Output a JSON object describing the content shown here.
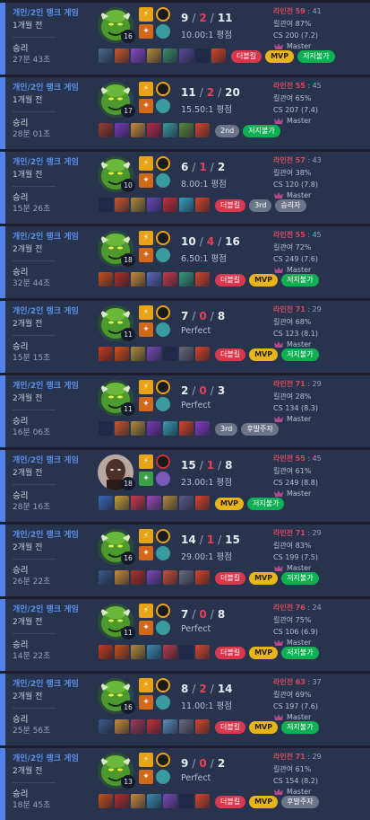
{
  "matches": [
    {
      "mode": "개인/2인 랭크 게임",
      "ago": "1개월 전",
      "result": "승리",
      "duration": "27분 43초",
      "champion": "green-brute",
      "level": "16",
      "spell_colors": [
        "#e8a317",
        "#d4681a"
      ],
      "rune_colors": [
        "#e8a317",
        "#3b9aa0"
      ],
      "kills": "9",
      "deaths": "2",
      "assists": "11",
      "ratio": "10.00:1 평점",
      "items": [
        "#4a6a8a",
        "#c85a2a",
        "#8a4ac8",
        "#b08a3a",
        "#3a8a6a",
        "#5a4a9a",
        "empty",
        "#d8452a"
      ],
      "badges": [
        {
          "label": "더블킬",
          "kind": "t"
        },
        {
          "label": "MVP",
          "kind": "m"
        },
        {
          "label": "저지불가",
          "kind": "g"
        }
      ],
      "lane_label": "라인전",
      "lane_score": "59",
      "lane_opp": "41",
      "kp": "킬관여 87%",
      "cs": "CS 200 (7.2)",
      "tier": "Master"
    },
    {
      "mode": "개인/2인 랭크 게임",
      "ago": "1개월 전",
      "result": "승리",
      "duration": "28분 01초",
      "champion": "green-brute",
      "level": "17",
      "spell_colors": [
        "#e8a317",
        "#d4681a"
      ],
      "rune_colors": [
        "#e8a317",
        "#3b9aa0"
      ],
      "kills": "11",
      "deaths": "2",
      "assists": "20",
      "ratio": "15.50:1 평점",
      "items": [
        "#a03a2a",
        "#7a3ab8",
        "#c88a3a",
        "#b82a4a",
        "#3a9a9a",
        "#5a8a3a",
        "#d8452a"
      ],
      "badges": [
        {
          "label": "2nd",
          "kind": "r"
        },
        {
          "label": "저지불가",
          "kind": "g"
        }
      ],
      "lane_label": "라인전",
      "lane_score": "55",
      "lane_opp": "45",
      "kp": "킬관여 65%",
      "cs": "CS 207 (7.4)",
      "tier": "Master"
    },
    {
      "mode": "개인/2인 랭크 게임",
      "ago": "1개월 전",
      "result": "승리",
      "duration": "15분 26초",
      "champion": "green-brute",
      "level": "10",
      "spell_colors": [
        "#e8a317",
        "#d4681a"
      ],
      "rune_colors": [
        "#e8a317",
        "#3b9aa0"
      ],
      "kills": "6",
      "deaths": "1",
      "assists": "2",
      "ratio": "8.00:1 평점",
      "items": [
        "empty",
        "#c85a2a",
        "#b08a3a",
        "#6a4ab8",
        "#c8303a",
        "#3aa0c0",
        "#d8452a"
      ],
      "badges": [
        {
          "label": "더블킬",
          "kind": "t"
        },
        {
          "label": "3rd",
          "kind": "r"
        },
        {
          "label": "승리자",
          "kind": "r"
        }
      ],
      "lane_label": "라인전",
      "lane_score": "57",
      "lane_opp": "43",
      "kp": "킬관여 38%",
      "cs": "CS 120 (7.8)",
      "tier": "Master"
    },
    {
      "mode": "개인/2인 랭크 게임",
      "ago": "2개월 전",
      "result": "승리",
      "duration": "32분 44초",
      "champion": "green-brute",
      "level": "18",
      "spell_colors": [
        "#e8a317",
        "#d4681a"
      ],
      "rune_colors": [
        "#e8a317",
        "#3b9aa0"
      ],
      "kills": "10",
      "deaths": "4",
      "assists": "16",
      "ratio": "6.50:1 평점",
      "items": [
        "#c8501a",
        "#b0302a",
        "#c88a3a",
        "#5a6ab8",
        "#c83a4a",
        "#3a9a7a",
        "#d8452a"
      ],
      "badges": [
        {
          "label": "더블킬",
          "kind": "t"
        },
        {
          "label": "MVP",
          "kind": "m"
        },
        {
          "label": "저지불가",
          "kind": "g"
        }
      ],
      "lane_label": "라인전",
      "lane_score": "55",
      "lane_opp": "45",
      "kp": "킬관여 72%",
      "cs": "CS 249 (7.6)",
      "tier": "Master"
    },
    {
      "mode": "개인/2인 랭크 게임",
      "ago": "2개월 전",
      "result": "승리",
      "duration": "15분 15초",
      "champion": "green-brute",
      "level": "11",
      "spell_colors": [
        "#e8a317",
        "#d4681a"
      ],
      "rune_colors": [
        "#e8a317",
        "#3b9aa0"
      ],
      "kills": "7",
      "deaths": "0",
      "assists": "8",
      "ratio": "Perfect",
      "items": [
        "#c83a1a",
        "#d8501a",
        "#b08a3a",
        "#7a4ab8",
        "empty",
        "#6a6a7a",
        "#d8452a"
      ],
      "badges": [
        {
          "label": "더블킬",
          "kind": "t"
        },
        {
          "label": "MVP",
          "kind": "m"
        },
        {
          "label": "저지불가",
          "kind": "g"
        }
      ],
      "lane_label": "라인전",
      "lane_score": "71",
      "lane_opp": "29",
      "kp": "킬관여 68%",
      "cs": "CS 123 (8.1)",
      "tier": "Master"
    },
    {
      "mode": "개인/2인 랭크 게임",
      "ago": "2개월 전",
      "result": "승리",
      "duration": "16분 06초",
      "champion": "green-brute",
      "level": "11",
      "spell_colors": [
        "#e8a317",
        "#d4681a"
      ],
      "rune_colors": [
        "#e8a317",
        "#3b9aa0"
      ],
      "kills": "2",
      "deaths": "0",
      "assists": "3",
      "ratio": "Perfect",
      "items": [
        "empty",
        "#c85a2a",
        "#b08a3a",
        "#7a3ab8",
        "#3a9ab0",
        "#d8452a",
        "#8a3ac8"
      ],
      "badges": [
        {
          "label": "3rd",
          "kind": "r"
        },
        {
          "label": "후발주자",
          "kind": "r"
        }
      ],
      "lane_label": "라인전",
      "lane_score": "71",
      "lane_opp": "29",
      "kp": "킬관여 28%",
      "cs": "CS 134 (8.3)",
      "tier": "Master"
    },
    {
      "mode": "개인/2인 랭크 게임",
      "ago": "2개월 전",
      "result": "승리",
      "duration": "28분 16초",
      "champion": "dark-assassin",
      "level": "18",
      "spell_colors": [
        "#e8a317",
        "#3aa04a"
      ],
      "rune_colors": [
        "#c8303a",
        "#7a5ab8"
      ],
      "kills": "15",
      "deaths": "1",
      "assists": "8",
      "ratio": "23.00:1 평점",
      "items": [
        "#3a6ab8",
        "#c8a03a",
        "#c83a4a",
        "#9a4ab8",
        "#b08a3a",
        "#5a5a8a",
        "#d8452a"
      ],
      "badges": [
        {
          "label": "MVP",
          "kind": "m"
        },
        {
          "label": "저지불가",
          "kind": "g"
        }
      ],
      "lane_label": "라인전",
      "lane_score": "55",
      "lane_opp": "45",
      "kp": "킬관여 61%",
      "cs": "CS 249 (8.8)",
      "tier": "Master"
    },
    {
      "mode": "개인/2인 랭크 게임",
      "ago": "2개월 전",
      "result": "승리",
      "duration": "26분 22초",
      "champion": "green-brute",
      "level": "16",
      "spell_colors": [
        "#e8a317",
        "#d4681a"
      ],
      "rune_colors": [
        "#e8a317",
        "#3b9aa0"
      ],
      "kills": "14",
      "deaths": "1",
      "assists": "15",
      "ratio": "29.00:1 평점",
      "items": [
        "#3a5a8a",
        "#c88a3a",
        "#b0302a",
        "#7a4ab8",
        "#c8503a",
        "#6a6a7a",
        "#d8452a"
      ],
      "badges": [
        {
          "label": "더블킬",
          "kind": "t"
        },
        {
          "label": "MVP",
          "kind": "m"
        },
        {
          "label": "저지불가",
          "kind": "g"
        }
      ],
      "lane_label": "라인전",
      "lane_score": "71",
      "lane_opp": "29",
      "kp": "킬관여 83%",
      "cs": "CS 199 (7.5)",
      "tier": "Master"
    },
    {
      "mode": "개인/2인 랭크 게임",
      "ago": "2개월 전",
      "result": "승리",
      "duration": "14분 22초",
      "champion": "green-brute",
      "level": "11",
      "spell_colors": [
        "#e8a317",
        "#d4681a"
      ],
      "rune_colors": [
        "#e8a317",
        "#3b9aa0"
      ],
      "kills": "7",
      "deaths": "0",
      "assists": "8",
      "ratio": "Perfect",
      "items": [
        "#c83a1a",
        "#c8501a",
        "#b08a3a",
        "#3a8ab0",
        "#b83a4a",
        "empty",
        "#d8452a"
      ],
      "badges": [
        {
          "label": "더블킬",
          "kind": "t"
        },
        {
          "label": "MVP",
          "kind": "m"
        },
        {
          "label": "저지불가",
          "kind": "g"
        }
      ],
      "lane_label": "라인전",
      "lane_score": "76",
      "lane_opp": "24",
      "kp": "킬관여 75%",
      "cs": "CS 106 (6.9)",
      "tier": "Master"
    },
    {
      "mode": "개인/2인 랭크 게임",
      "ago": "2개월 전",
      "result": "승리",
      "duration": "25분 56초",
      "champion": "green-brute",
      "level": "16",
      "spell_colors": [
        "#e8a317",
        "#d4681a"
      ],
      "rune_colors": [
        "#e8a317",
        "#3b9aa0"
      ],
      "kills": "8",
      "deaths": "2",
      "assists": "14",
      "ratio": "11.00:1 평점",
      "items": [
        "#3a5a8a",
        "#c88a3a",
        "#a03a5a",
        "#c8303a",
        "#5a8ab8",
        "#6a6a7a",
        "#d8452a"
      ],
      "badges": [
        {
          "label": "더블킬",
          "kind": "t"
        },
        {
          "label": "MVP",
          "kind": "m"
        },
        {
          "label": "저지불가",
          "kind": "g"
        }
      ],
      "lane_label": "라인전",
      "lane_score": "63",
      "lane_opp": "37",
      "kp": "킬관여 69%",
      "cs": "CS 197 (7.6)",
      "tier": "Master"
    },
    {
      "mode": "개인/2인 랭크 게임",
      "ago": "2개월 전",
      "result": "승리",
      "duration": "18분 45초",
      "champion": "green-brute",
      "level": "13",
      "spell_colors": [
        "#e8a317",
        "#d4681a"
      ],
      "rune_colors": [
        "#e8a317",
        "#3b9aa0"
      ],
      "kills": "9",
      "deaths": "0",
      "assists": "2",
      "ratio": "Perfect",
      "items": [
        "#c8501a",
        "#b0302a",
        "#c88a3a",
        "#3a8ab0",
        "#7a4ab8",
        "empty",
        "#d8452a"
      ],
      "badges": [
        {
          "label": "더블킬",
          "kind": "t"
        },
        {
          "label": "MVP",
          "kind": "m"
        },
        {
          "label": "후발주자",
          "kind": "r"
        }
      ],
      "lane_label": "라인전",
      "lane_score": "71",
      "lane_opp": "29",
      "kp": "킬관여 61%",
      "cs": "CS 154 (8.2)",
      "tier": "Master"
    }
  ]
}
